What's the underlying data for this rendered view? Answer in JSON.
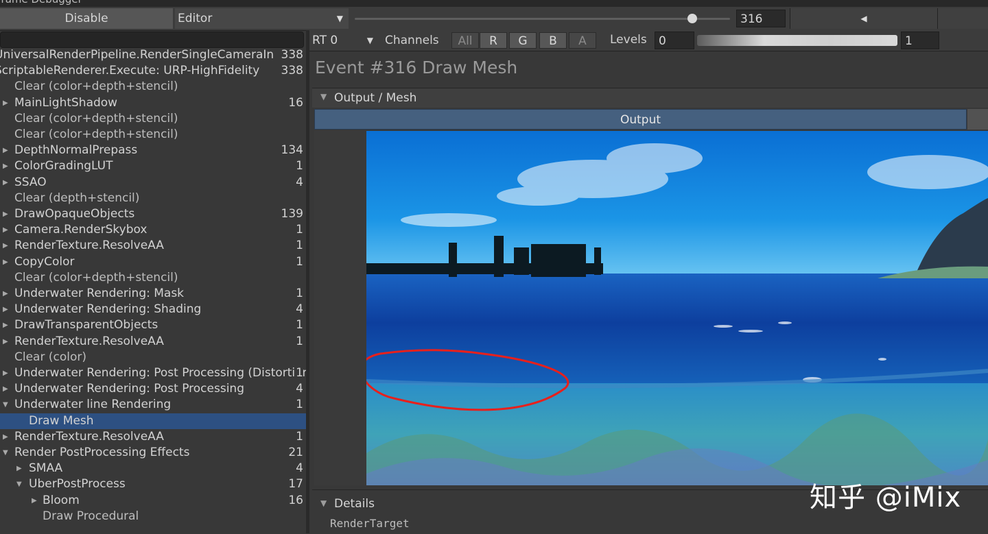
{
  "window": {
    "title": "Frame Debugger"
  },
  "toolbar": {
    "disable_label": "Disable",
    "target_value": "Editor",
    "event_index": "316",
    "event_progress": 0.9,
    "prev_icon": "triangle-left-icon"
  },
  "tree": [
    {
      "label": "UniversalRenderPipeline.RenderSingleCameraIn",
      "count": "338",
      "level": 0,
      "arrow": "none",
      "dim": false,
      "selected": false
    },
    {
      "label": "ScriptableRenderer.Execute: URP-HighFidelity",
      "count": "338",
      "level": 0,
      "arrow": "none",
      "dim": false,
      "selected": false
    },
    {
      "label": "Clear (color+depth+stencil)",
      "count": "",
      "level": 1,
      "arrow": "none",
      "dim": true,
      "selected": false
    },
    {
      "label": "MainLightShadow",
      "count": "16",
      "level": 1,
      "arrow": "collapsed",
      "dim": false,
      "selected": false
    },
    {
      "label": "Clear (color+depth+stencil)",
      "count": "",
      "level": 1,
      "arrow": "none",
      "dim": true,
      "selected": false
    },
    {
      "label": "Clear (color+depth+stencil)",
      "count": "",
      "level": 1,
      "arrow": "none",
      "dim": true,
      "selected": false
    },
    {
      "label": "DepthNormalPrepass",
      "count": "134",
      "level": 1,
      "arrow": "collapsed",
      "dim": false,
      "selected": false
    },
    {
      "label": "ColorGradingLUT",
      "count": "1",
      "level": 1,
      "arrow": "collapsed",
      "dim": false,
      "selected": false
    },
    {
      "label": "SSAO",
      "count": "4",
      "level": 1,
      "arrow": "collapsed",
      "dim": false,
      "selected": false
    },
    {
      "label": "Clear (depth+stencil)",
      "count": "",
      "level": 1,
      "arrow": "none",
      "dim": true,
      "selected": false
    },
    {
      "label": "DrawOpaqueObjects",
      "count": "139",
      "level": 1,
      "arrow": "collapsed",
      "dim": false,
      "selected": false
    },
    {
      "label": "Camera.RenderSkybox",
      "count": "1",
      "level": 1,
      "arrow": "collapsed",
      "dim": false,
      "selected": false
    },
    {
      "label": "RenderTexture.ResolveAA",
      "count": "1",
      "level": 1,
      "arrow": "collapsed",
      "dim": false,
      "selected": false
    },
    {
      "label": "CopyColor",
      "count": "1",
      "level": 1,
      "arrow": "collapsed",
      "dim": false,
      "selected": false
    },
    {
      "label": "Clear (color+depth+stencil)",
      "count": "",
      "level": 1,
      "arrow": "none",
      "dim": true,
      "selected": false
    },
    {
      "label": "Underwater Rendering: Mask",
      "count": "1",
      "level": 1,
      "arrow": "collapsed",
      "dim": false,
      "selected": false
    },
    {
      "label": "Underwater Rendering: Shading",
      "count": "4",
      "level": 1,
      "arrow": "collapsed",
      "dim": false,
      "selected": false
    },
    {
      "label": "DrawTransparentObjects",
      "count": "1",
      "level": 1,
      "arrow": "collapsed",
      "dim": false,
      "selected": false
    },
    {
      "label": "RenderTexture.ResolveAA",
      "count": "1",
      "level": 1,
      "arrow": "collapsed",
      "dim": false,
      "selected": false
    },
    {
      "label": "Clear (color)",
      "count": "",
      "level": 1,
      "arrow": "none",
      "dim": true,
      "selected": false
    },
    {
      "label": "Underwater Rendering: Post Processing (Distortion)",
      "count": "1",
      "level": 1,
      "arrow": "collapsed",
      "dim": false,
      "selected": false
    },
    {
      "label": "Underwater Rendering: Post Processing",
      "count": "4",
      "level": 1,
      "arrow": "collapsed",
      "dim": false,
      "selected": false
    },
    {
      "label": "Underwater line Rendering",
      "count": "1",
      "level": 1,
      "arrow": "expanded",
      "dim": false,
      "selected": false
    },
    {
      "label": "Draw Mesh",
      "count": "",
      "level": 2,
      "arrow": "none",
      "dim": false,
      "selected": true
    },
    {
      "label": "RenderTexture.ResolveAA",
      "count": "1",
      "level": 1,
      "arrow": "collapsed",
      "dim": false,
      "selected": false
    },
    {
      "label": "Render PostProcessing Effects",
      "count": "21",
      "level": 1,
      "arrow": "expanded",
      "dim": false,
      "selected": false
    },
    {
      "label": "SMAA",
      "count": "4",
      "level": 2,
      "arrow": "collapsed",
      "dim": false,
      "selected": false
    },
    {
      "label": "UberPostProcess",
      "count": "17",
      "level": 2,
      "arrow": "expanded",
      "dim": false,
      "selected": false
    },
    {
      "label": "Bloom",
      "count": "16",
      "level": 3,
      "arrow": "collapsed",
      "dim": false,
      "selected": false
    },
    {
      "label": "Draw Procedural",
      "count": "",
      "level": 3,
      "arrow": "none",
      "dim": true,
      "selected": false
    }
  ],
  "render_target": {
    "rt_value": "RT 0",
    "channels_label": "Channels",
    "channels": [
      {
        "label": "All",
        "active": false
      },
      {
        "label": "R",
        "active": true
      },
      {
        "label": "G",
        "active": true
      },
      {
        "label": "B",
        "active": true
      },
      {
        "label": "A",
        "active": false
      }
    ],
    "levels_label": "Levels",
    "levels_min": "0",
    "levels_max": "1"
  },
  "event": {
    "title": "Event #316 Draw Mesh"
  },
  "output": {
    "section_label": "Output / Mesh",
    "tab_label": "Output"
  },
  "details": {
    "section_label": "Details",
    "first_row": "RenderTarget"
  },
  "watermark": "知乎 @iMix",
  "colors": {
    "selection": "#2d5082",
    "output_tab": "#45607f",
    "annotation": "#e8201c",
    "sky": "#1b8ee0",
    "ocean": "#0d3f9e"
  }
}
